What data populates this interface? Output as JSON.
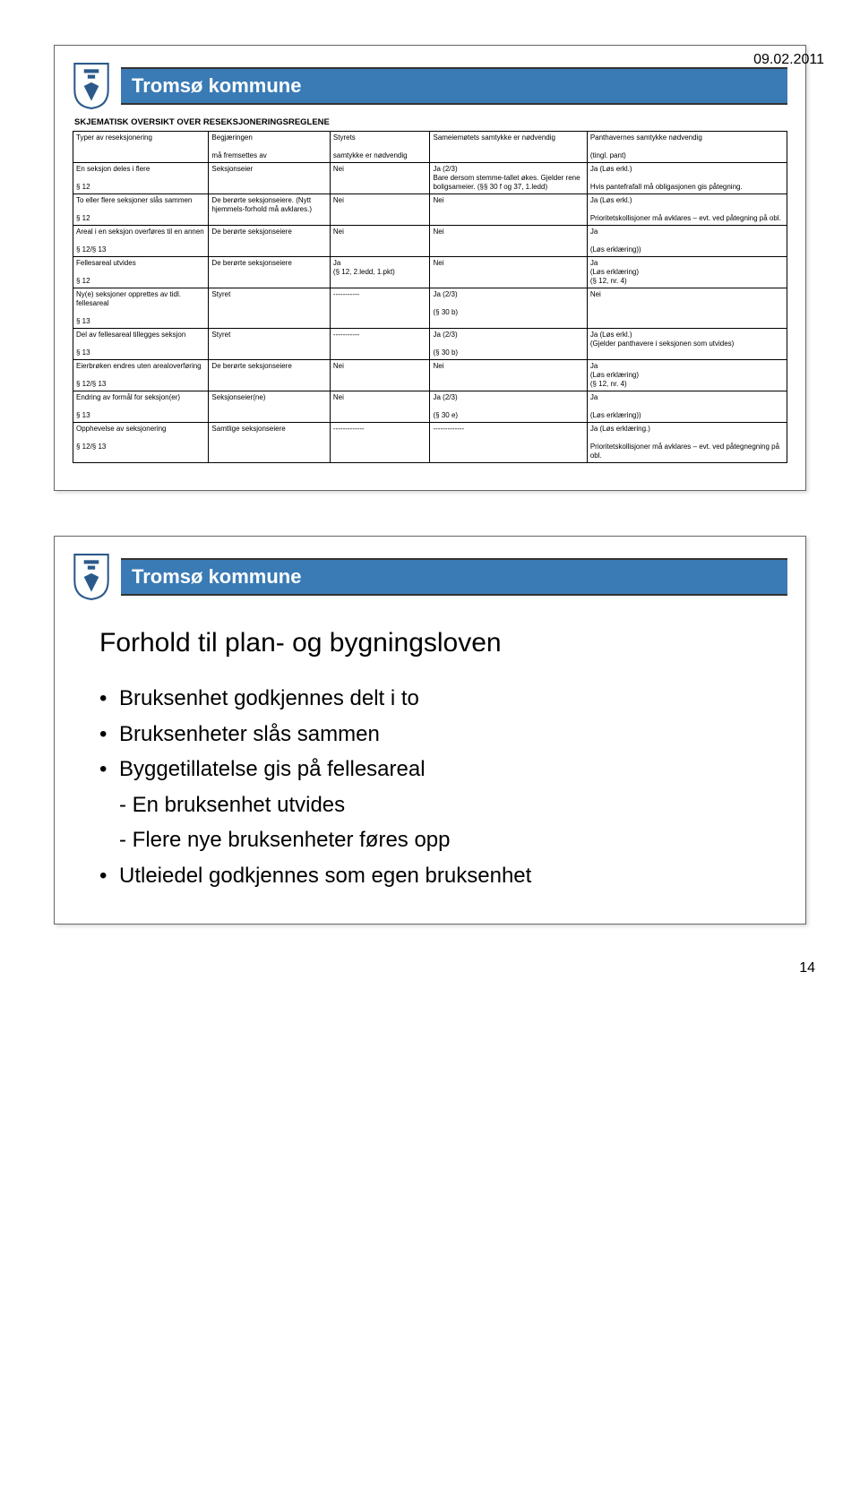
{
  "date": "09.02.2011",
  "page_number": "14",
  "logo_text": "Tromsø kommune",
  "slide1": {
    "title": "SKJEMATISK OVERSIKT OVER RESEKSJONERINGSREGLENE",
    "header": {
      "c1": "Typer av reseksjonering",
      "c2": "Begjæringen\n\nmå fremsettes av",
      "c3": "Styrets\n\nsamtykke er nødvendig",
      "c4": "Sameiemøtets samtykke er nødvendig",
      "c5": "Panthavernes samtykke nødvendig\n\n(tingl. pant)"
    },
    "rows": [
      {
        "c1": "En seksjon deles i flere\n\n§ 12",
        "c2": "Seksjonseier",
        "c3": "Nei",
        "c4": "Ja (2/3)\nBare dersom stemme-tallet økes. Gjelder rene boligsameier. (§§ 30 f og 37, 1.ledd)",
        "c5": "Ja (Løs erkl.)\n\nHvis pantefrafall må obligasjonen gis påtegning."
      },
      {
        "c1": "To eller flere seksjoner slås sammen\n\n§ 12",
        "c2": "De berørte seksjonseiere. (Nytt hjemmels-forhold må avklares.)",
        "c3": "Nei",
        "c4": "Nei",
        "c5": "Ja (Løs erkl.)\n\nPrioritetskollisjoner må avklares – evt. ved påtegning på obl."
      },
      {
        "c1": "Areal i en seksjon overføres til en annen\n\n§ 12/§ 13",
        "c2": "De berørte seksjonseiere",
        "c3": "Nei",
        "c4": "Nei",
        "c5": "Ja\n\n(Løs erklæring))"
      },
      {
        "c1": "Fellesareal utvides\n\n§ 12",
        "c2": "De berørte seksjonseiere",
        "c3": "Ja\n(§ 12, 2.ledd, 1.pkt)",
        "c4": "Nei",
        "c5": "Ja\n(Løs erklæring)\n(§ 12, nr. 4)"
      },
      {
        "c1": "Ny(e) seksjoner opprettes av tidl. fellesareal\n\n§ 13",
        "c2": "Styret",
        "c3": "-----------",
        "c4": "Ja (2/3)\n\n(§ 30 b)",
        "c5": "Nei"
      },
      {
        "c1": "Del av fellesareal tillegges seksjon\n\n§ 13",
        "c2": "Styret",
        "c3": "-----------",
        "c4": "Ja (2/3)\n\n(§ 30 b)",
        "c5": "Ja (Løs erkl.)\n(Gjelder panthavere i seksjonen som utvides)"
      },
      {
        "c1": "Eierbrøken endres uten arealoverføring\n\n§ 12/§ 13",
        "c2": "De berørte seksjonseiere",
        "c3": "Nei",
        "c4": "Nei",
        "c5": "Ja\n(Løs erklæring)\n(§ 12, nr. 4)"
      },
      {
        "c1": "Endring av formål for seksjon(er)\n\n§ 13",
        "c2": "Seksjonseier(ne)",
        "c3": "Nei",
        "c4": "Ja (2/3)\n\n(§ 30 e)",
        "c5": "Ja\n\n(Løs erklæring))"
      },
      {
        "c1": "Opphevelse av seksjonering\n\n§ 12/§ 13",
        "c2": "Samtlige seksjonseiere",
        "c3": "-------------",
        "c4": "-------------",
        "c5": "Ja (Løs erklæring.)\n\nPrioritetskollisjoner må avklares – evt. ved påtegnegning på obl."
      }
    ]
  },
  "slide2": {
    "title": "Forhold til plan- og bygningsloven",
    "bullets": [
      "Bruksenhet godkjennes delt i to",
      "Bruksenheter slås sammen",
      "Byggetillatelse gis på fellesareal"
    ],
    "subs": [
      "- En bruksenhet utvides",
      "- Flere nye bruksenheter føres opp"
    ],
    "bullets2": [
      "Utleiedel godkjennes som egen bruksenhet"
    ]
  }
}
